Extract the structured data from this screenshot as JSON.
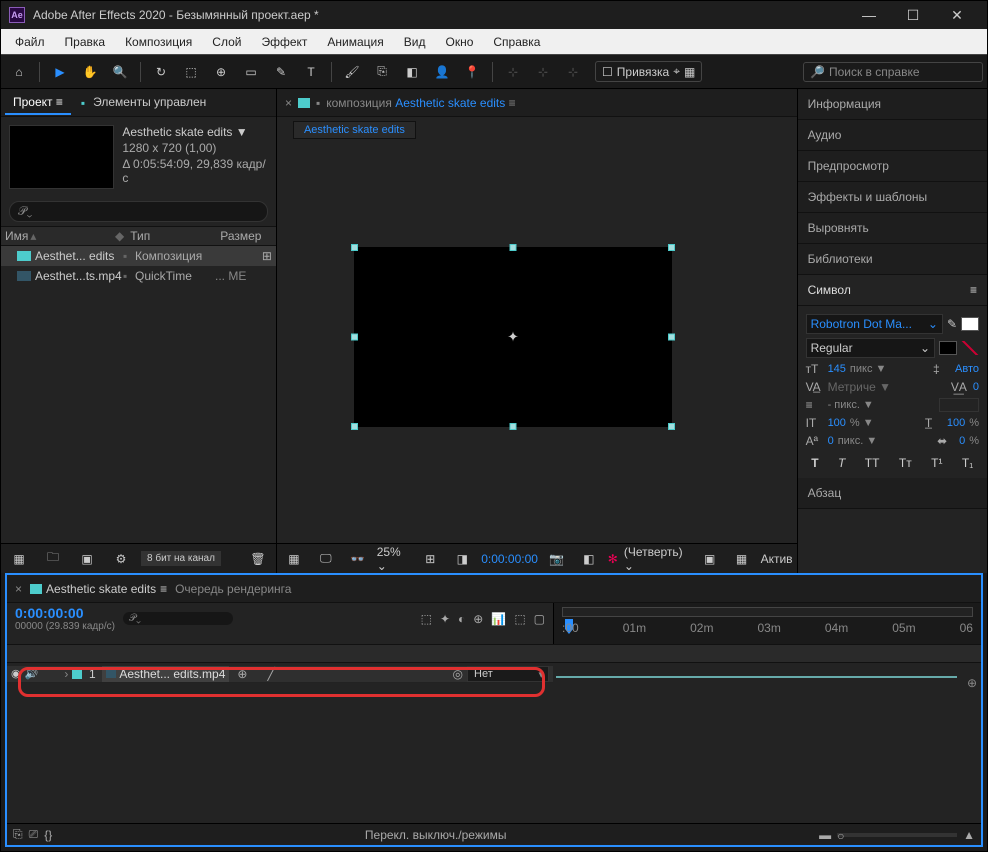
{
  "titlebar": {
    "app": "Ae",
    "title": "Adobe After Effects 2020 - Безымянный проект.aep *"
  },
  "menu": [
    "Файл",
    "Правка",
    "Композиция",
    "Слой",
    "Эффект",
    "Анимация",
    "Вид",
    "Окно",
    "Справка"
  ],
  "toolbar": {
    "snap_label": "Привязка",
    "search_placeholder": "Поиск в справке"
  },
  "project": {
    "tab_project": "Проект",
    "tab_controls": "Элементы управлен",
    "comp_name": "Aesthetic skate edits ▼",
    "comp_dims": "1280 x 720 (1,00)",
    "comp_duration": "Δ 0:05:54:09, 29,839 кадр/с",
    "cols": {
      "name": "Имя",
      "type": "Тип",
      "size": "Размер"
    },
    "rows": [
      {
        "name": "Aesthet... edits",
        "type": "Композиция",
        "folder": true
      },
      {
        "name": "Aesthet...ts.mp4",
        "type": "QuickTime",
        "extra": "... ME"
      }
    ],
    "bitdepth": "8 бит на канал"
  },
  "viewer": {
    "bc_prefix": "композиция",
    "bc_name": "Aesthetic skate edits",
    "subtab": "Aesthetic skate edits",
    "zoom": "25%",
    "time": "0:00:00:00",
    "res": "(Четверть)",
    "active": "Актив"
  },
  "right": {
    "info": "Информация",
    "audio": "Аудио",
    "preview": "Предпросмотр",
    "fx": "Эффекты и шаблоны",
    "align": "Выровнять",
    "libs": "Библиотеки",
    "char": "Символ",
    "para": "Абзац",
    "font": "Robotron Dot Ma...",
    "style": "Regular",
    "size_val": "145",
    "size_unit": "пикс ▼",
    "leading": "Авто",
    "kerning": "Метриче ▼",
    "tracking": "0",
    "line": "- пикс. ▼",
    "hscale": "100",
    "hscale_u": "% ▼",
    "vscale": "100",
    "vscale_u": "%",
    "baseline": "0",
    "baseline_u": "пикс. ▼",
    "tsume": "0",
    "tsume_u": "%"
  },
  "timeline": {
    "tab_name": "Aesthetic skate edits",
    "tab_render": "Очередь рендеринга",
    "timecode": "0:00:00:00",
    "framerate": "00000 (29.839 кадр/с)",
    "marks": [
      ":00",
      "01m",
      "02m",
      "03m",
      "04m",
      "05m",
      "06"
    ],
    "layer": {
      "num": "1",
      "name": "Aesthet... edits.mp4",
      "parent": "Нет"
    },
    "footer": "Перекл. выключ./режимы"
  }
}
